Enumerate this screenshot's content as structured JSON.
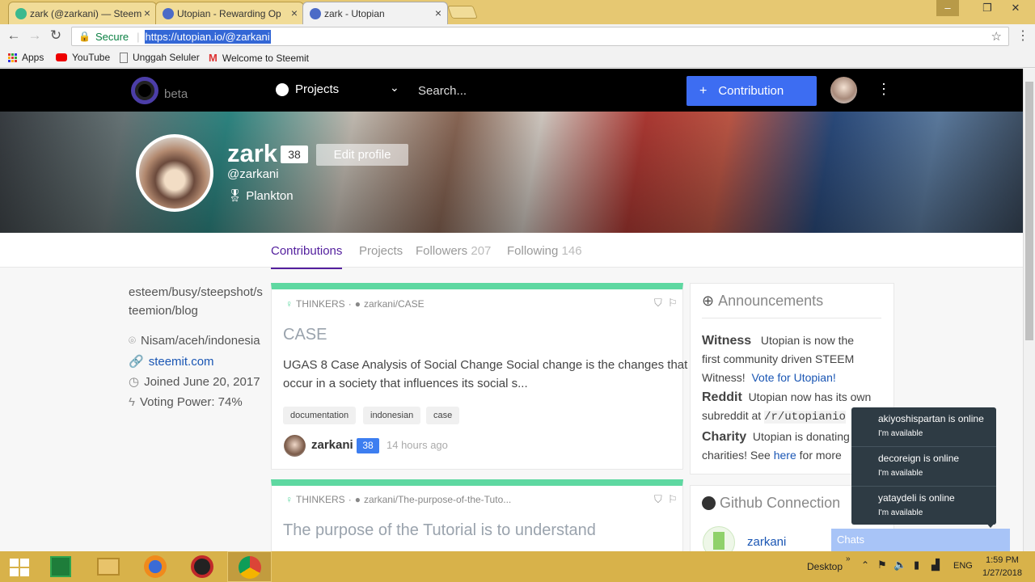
{
  "browser": {
    "tabs": [
      {
        "title": "zark (@zarkani) — Steem"
      },
      {
        "title": "Utopian - Rewarding Op"
      },
      {
        "title": "zark - Utopian"
      }
    ],
    "window_controls": {
      "minimize": "‒",
      "restore": "❐",
      "close": "✕"
    },
    "secure_label": "Secure",
    "url": "https://utopian.io/@zarkani",
    "bookmarks": [
      "Apps",
      "YouTube",
      "Unggah Seluler",
      "Welcome to Steemit"
    ]
  },
  "site": {
    "beta_label": "beta",
    "projects_label": "Projects",
    "search_placeholder": "Search...",
    "contribution_button": "Contribution"
  },
  "profile": {
    "name": "zark",
    "reputation": "38",
    "edit_label": "Edit profile",
    "handle": "@zarkani",
    "rank": "Plankton",
    "tabs": {
      "contributions": "Contributions",
      "projects": "Projects",
      "followers": "Followers",
      "followers_count": "207",
      "following": "Following",
      "following_count": "146"
    },
    "about_line1": "esteem/busy/steepshot/s",
    "about_line2": "teemion/blog",
    "location": "Nisam/aceh/indonesia",
    "website": "steemit.com",
    "joined": "Joined June 20, 2017",
    "voting_power": "Voting Power: 74%"
  },
  "posts": [
    {
      "category": "THINKERS",
      "repo": "zarkani/CASE",
      "title": "CASE",
      "excerpt_line1": "UGAS 8 Case Analysis of Social Change Social change is the changes that",
      "excerpt_line2": "occur in a society that influences its social s...",
      "tags": [
        "documentation",
        "indonesian",
        "case"
      ],
      "author": "zarkani",
      "author_rep": "38",
      "time": "14 hours ago"
    },
    {
      "category": "THINKERS",
      "repo": "zarkani/The-purpose-of-the-Tuto...",
      "title": "The purpose of the Tutorial is to understand"
    }
  ],
  "announcements": {
    "title": "Announcements",
    "witness_label": "Witness",
    "witness_line1": "Utopian is now the",
    "witness_line2": "first community driven STEEM",
    "witness_line3": "Witness!",
    "witness_link": "Vote for Utopian!",
    "reddit_label": "Reddit",
    "reddit_line1": "Utopian now has its own",
    "reddit_line2": "subreddit at",
    "reddit_code": "/r/utopianio",
    "charity_label": "Charity",
    "charity_line1": "Utopian is donating",
    "charity_line2": "charities! See",
    "charity_link": "here",
    "charity_line3": "for more"
  },
  "github": {
    "title": "Github Connection",
    "user": "zarkani"
  },
  "chat": {
    "notifications": [
      {
        "title": "akiyoshispartan is online",
        "status": "I'm available"
      },
      {
        "title": "decoreign is online",
        "status": "I'm available"
      },
      {
        "title": "yataydeli is online",
        "status": "I'm available"
      }
    ],
    "bar_label": "Chats"
  },
  "taskbar": {
    "desktop_label": "Desktop",
    "language": "ENG",
    "time": "1:59 PM",
    "date": "1/27/2018"
  },
  "colors": {
    "brand_blue": "#3d6df2",
    "utopian_purple": "#54209e",
    "card_green": "#5ed8a1",
    "tab_accent": "#e6c872"
  }
}
